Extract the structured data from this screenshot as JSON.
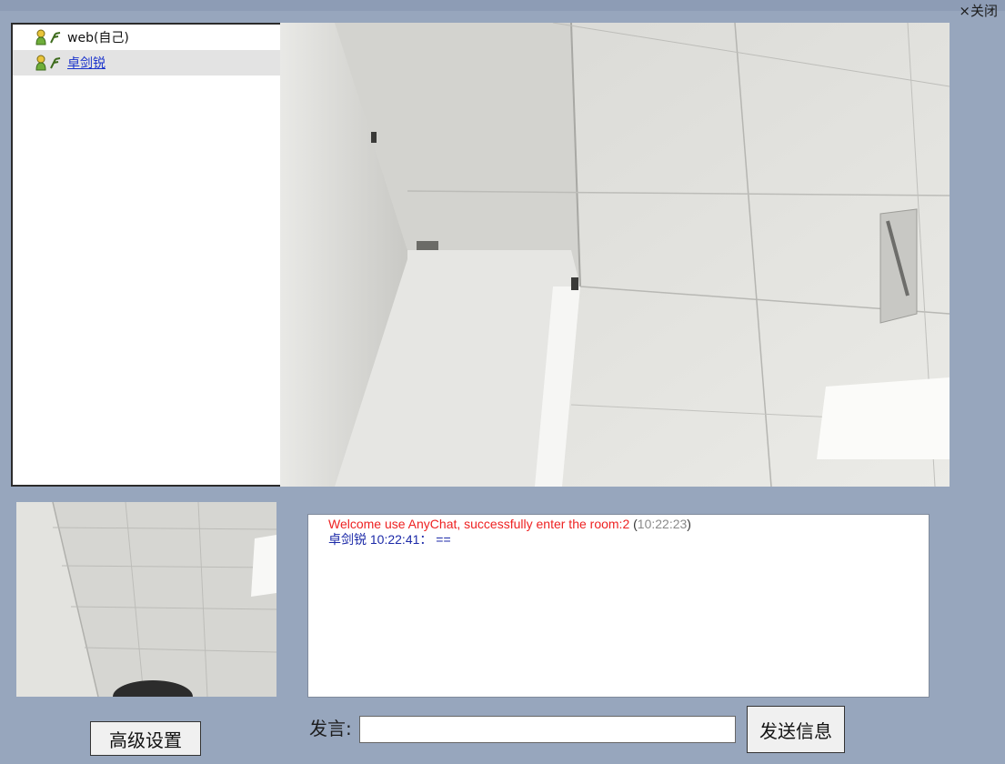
{
  "header": {
    "close_label": "×关闭"
  },
  "user_list": {
    "users": [
      {
        "name": "web(自己)",
        "selected": false,
        "link": false
      },
      {
        "name": "卓剑锐",
        "selected": true,
        "link": true
      }
    ],
    "icons": [
      "person-icon",
      "signal-icon"
    ]
  },
  "chat": {
    "system_message": "Welcome use AnyChat, successfully enter the room:2",
    "system_time": "10:22:23",
    "user_message": {
      "user": "卓剑锐",
      "time": "10:22:41",
      "text": "=="
    }
  },
  "controls": {
    "advanced_settings_label": "高级设置",
    "speak_label": "发言:",
    "message_value": "",
    "send_label": "发送信息"
  },
  "colors": {
    "background": "#97a6bd",
    "system_message": "#ee2222",
    "user_message": "#1c2aa8",
    "link": "#1a33cc"
  }
}
